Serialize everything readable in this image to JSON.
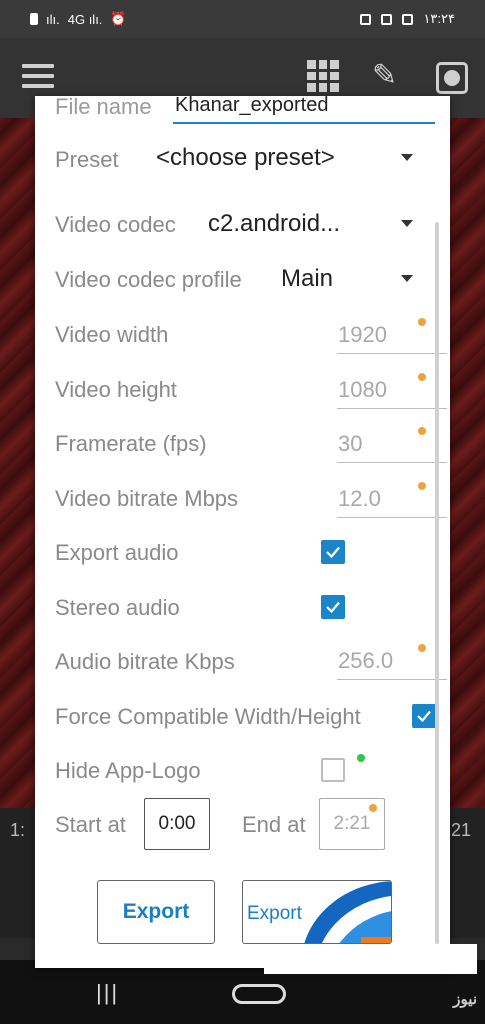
{
  "status_bar": {
    "time": "۱۳:۲۴",
    "signal": "ılı.",
    "signal2": "4G ılı.",
    "alarm": "⏰"
  },
  "timeline": {
    "left_time": "1:",
    "right_time": "21"
  },
  "dialog": {
    "file_name_label": "File name",
    "file_name_value": "Khanar_exported",
    "preset": {
      "label": "Preset",
      "value": "<choose preset>"
    },
    "video_codec": {
      "label": "Video codec",
      "value": "c2.android..."
    },
    "video_codec_profile": {
      "label": "Video codec profile",
      "value": "Main"
    },
    "video_width": {
      "label": "Video width",
      "value": "1920"
    },
    "video_height": {
      "label": "Video height",
      "value": "1080"
    },
    "framerate": {
      "label": "Framerate (fps)",
      "value": "30"
    },
    "video_bitrate": {
      "label": "Video bitrate Mbps",
      "value": "12.0"
    },
    "export_audio": {
      "label": "Export audio",
      "checked": true
    },
    "stereo_audio": {
      "label": "Stereo audio",
      "checked": true
    },
    "audio_bitrate": {
      "label": "Audio bitrate Kbps",
      "value": "256.0"
    },
    "force_compatible": {
      "label": "Force Compatible Width/Height",
      "checked": true
    },
    "hide_app_logo": {
      "label": "Hide App-Logo",
      "checked": false
    },
    "start_at": {
      "label": "Start at",
      "value": "0:00"
    },
    "end_at": {
      "label": "End at",
      "value": "2:21"
    },
    "export_button": "Export",
    "export2_button": "Export"
  },
  "watermark": "نیوز",
  "colors": {
    "accent": "#1a85c8",
    "orange_dot": "#f0a33a",
    "green_dot": "#2cc84a"
  }
}
